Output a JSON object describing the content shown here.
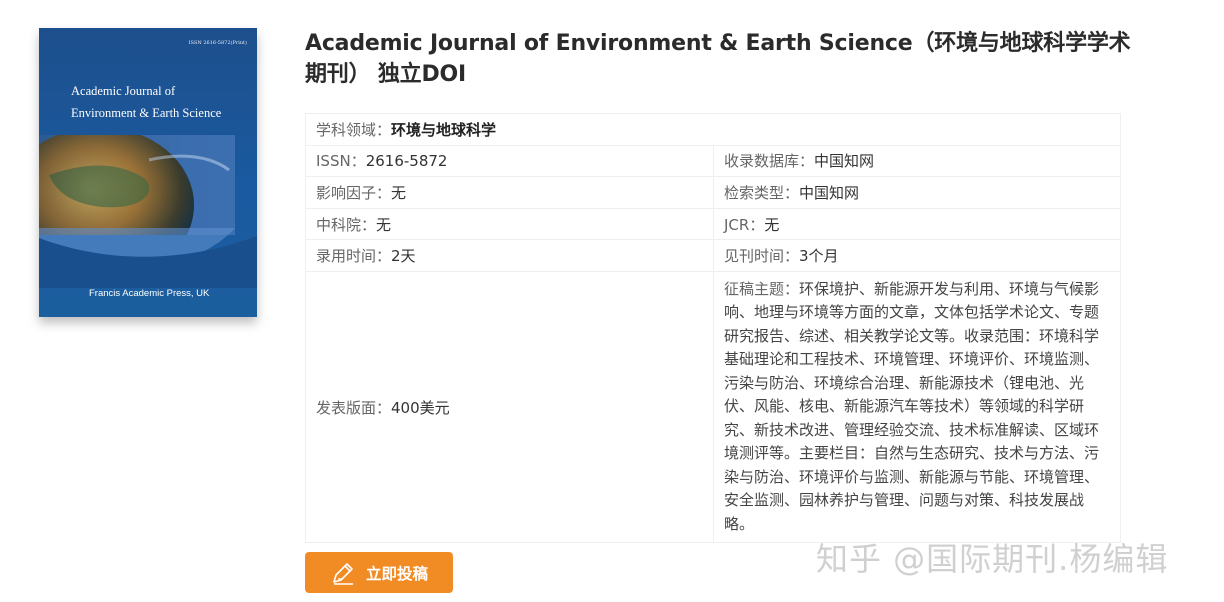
{
  "cover": {
    "issn": "ISSN 2616-5872(Print)",
    "title_line1": "Academic Journal of",
    "title_line2": "Environment & Earth Science",
    "publisher": "Francis Academic Press, UK"
  },
  "journal": {
    "title": "Academic Journal of Environment & Earth Science（环境与地球科学学术期刊） 独立DOI"
  },
  "info": {
    "field_label": "学科领域：",
    "field_value": "环境与地球科学",
    "issn_label": "ISSN：",
    "issn_value": "2616-5872",
    "database_label": "收录数据库：",
    "database_value": "中国知网",
    "impact_label": "影响因子：",
    "impact_value": "无",
    "search_label": "检索类型：",
    "search_value": "中国知网",
    "cas_label": "中科院：",
    "cas_value": "无",
    "jcr_label": "JCR：",
    "jcr_value": "无",
    "accept_label": "录用时间：",
    "accept_value": "2天",
    "publish_label": "见刊时间：",
    "publish_value": "3个月",
    "fee_label": "发表版面：",
    "fee_value": "400美元",
    "topic_label": "征稿主题：",
    "topic_value": "环保境护、新能源开发与利用、环境与气候影响、地理与环境等方面的文章，文体包括学术论文、专题研究报告、综述、相关教学论文等。收录范围：环境科学基础理论和工程技术、环境管理、环境评价、环境监测、污染与防治、环境综合治理、新能源技术（锂电池、光伏、风能、核电、新能源汽车等技术）等领域的科学研究、新技术改进、管理经验交流、技术标准解读、区域环境测评等。主要栏目：自然与生态研究、技术与方法、污染与防治、环境评价与监测、新能源与节能、环境管理、安全监测、园林养护与管理、问题与对策、科技发展战略。"
  },
  "actions": {
    "submit_label": "立即投稿"
  },
  "watermark": "知乎 @国际期刊.杨编辑",
  "colors": {
    "accent": "#f18b24",
    "cover_blue": "#1b5e9e"
  }
}
